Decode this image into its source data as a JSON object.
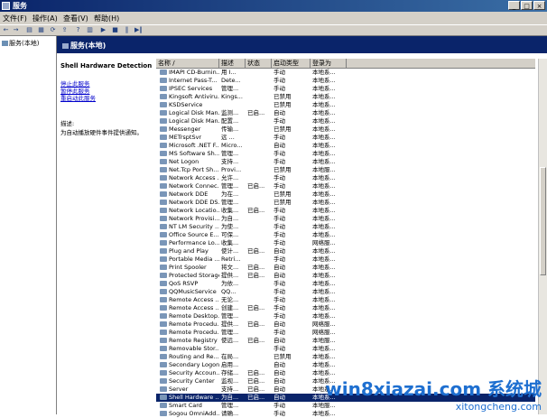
{
  "window": {
    "title": "服务"
  },
  "menu": [
    "文件(F)",
    "操作(A)",
    "查看(V)",
    "帮助(H)"
  ],
  "tree": {
    "root": "服务(本地)"
  },
  "header": {
    "title": "服务(本地)"
  },
  "desc": {
    "service_name": "Shell Hardware Detection",
    "link_stop": "停止此服务",
    "link_pause": "暂停此服务",
    "link_restart": "重启动此服务",
    "desc_label": "描述:",
    "desc_text": "为自动播放硬件事件提供通知。"
  },
  "columns": [
    "名称 /",
    "描述",
    "状态",
    "启动类型",
    "登录为"
  ],
  "services": [
    {
      "name": "IMAPI CD-Burnin...",
      "desc": "用 I...",
      "status": "",
      "startup": "手动",
      "logon": "本地系..."
    },
    {
      "name": "Internet Pass-T...",
      "desc": "Dete...",
      "status": "",
      "startup": "手动",
      "logon": "本地系..."
    },
    {
      "name": "IPSEC Services",
      "desc": "管理...",
      "status": "",
      "startup": "手动",
      "logon": "本地系..."
    },
    {
      "name": "Kingsoft Antiviru...",
      "desc": "Kings...",
      "status": "",
      "startup": "已禁用",
      "logon": "本地系..."
    },
    {
      "name": "KSDService",
      "desc": "",
      "status": "",
      "startup": "已禁用",
      "logon": "本地系..."
    },
    {
      "name": "Logical Disk Man...",
      "desc": "监测...",
      "status": "已启...",
      "startup": "自动",
      "logon": "本地系..."
    },
    {
      "name": "Logical Disk Man...",
      "desc": "配置...",
      "status": "",
      "startup": "手动",
      "logon": "本地系..."
    },
    {
      "name": "Messenger",
      "desc": "传输...",
      "status": "",
      "startup": "已禁用",
      "logon": "本地系..."
    },
    {
      "name": "METrsptSvr",
      "desc": "远 ...",
      "status": "",
      "startup": "手动",
      "logon": "本地系..."
    },
    {
      "name": "Microsoft .NET F...",
      "desc": "Micro...",
      "status": "",
      "startup": "自动",
      "logon": "本地系..."
    },
    {
      "name": "MS Software Sh...",
      "desc": "管理...",
      "status": "",
      "startup": "手动",
      "logon": "本地系..."
    },
    {
      "name": "Net Logon",
      "desc": "支持...",
      "status": "",
      "startup": "手动",
      "logon": "本地系..."
    },
    {
      "name": "Net.Tcp Port Sh...",
      "desc": "Provi...",
      "status": "",
      "startup": "已禁用",
      "logon": "本地服..."
    },
    {
      "name": "Network Access ...",
      "desc": "允许...",
      "status": "",
      "startup": "手动",
      "logon": "本地系..."
    },
    {
      "name": "Network Connec...",
      "desc": "管理...",
      "status": "已启...",
      "startup": "手动",
      "logon": "本地系..."
    },
    {
      "name": "Network DDE",
      "desc": "为在...",
      "status": "",
      "startup": "已禁用",
      "logon": "本地系..."
    },
    {
      "name": "Network DDE DS...",
      "desc": "管理...",
      "status": "",
      "startup": "已禁用",
      "logon": "本地系..."
    },
    {
      "name": "Network Locatio...",
      "desc": "收集...",
      "status": "已启...",
      "startup": "手动",
      "logon": "本地系..."
    },
    {
      "name": "Network Provisi...",
      "desc": "为自...",
      "status": "",
      "startup": "手动",
      "logon": "本地系..."
    },
    {
      "name": "NT LM Security ...",
      "desc": "为使...",
      "status": "",
      "startup": "手动",
      "logon": "本地系..."
    },
    {
      "name": "Office Source E...",
      "desc": "可保...",
      "status": "",
      "startup": "手动",
      "logon": "本地系..."
    },
    {
      "name": "Performance Lo...",
      "desc": "收集...",
      "status": "",
      "startup": "手动",
      "logon": "网络服..."
    },
    {
      "name": "Plug and Play",
      "desc": "使计...",
      "status": "已启...",
      "startup": "自动",
      "logon": "本地系..."
    },
    {
      "name": "Portable Media ...",
      "desc": "Retri...",
      "status": "",
      "startup": "手动",
      "logon": "本地系..."
    },
    {
      "name": "Print Spooler",
      "desc": "将文...",
      "status": "已启...",
      "startup": "自动",
      "logon": "本地系..."
    },
    {
      "name": "Protected Storage",
      "desc": "提供...",
      "status": "已启...",
      "startup": "自动",
      "logon": "本地系..."
    },
    {
      "name": "QoS RSVP",
      "desc": "为依...",
      "status": "",
      "startup": "手动",
      "logon": "本地系..."
    },
    {
      "name": "QQMusicService",
      "desc": "QQ...",
      "status": "",
      "startup": "手动",
      "logon": "本地系..."
    },
    {
      "name": "Remote Access ...",
      "desc": "无论...",
      "status": "",
      "startup": "手动",
      "logon": "本地系..."
    },
    {
      "name": "Remote Access ...",
      "desc": "创建...",
      "status": "已启...",
      "startup": "手动",
      "logon": "本地系..."
    },
    {
      "name": "Remote Desktop...",
      "desc": "管理...",
      "status": "",
      "startup": "手动",
      "logon": "本地系..."
    },
    {
      "name": "Remote Procedu...",
      "desc": "提供...",
      "status": "已启...",
      "startup": "自动",
      "logon": "网络服..."
    },
    {
      "name": "Remote Procedu...",
      "desc": "管理...",
      "status": "",
      "startup": "手动",
      "logon": "网络服..."
    },
    {
      "name": "Remote Registry",
      "desc": "使远...",
      "status": "已启...",
      "startup": "自动",
      "logon": "本地服..."
    },
    {
      "name": "Removable Stor...",
      "desc": "",
      "status": "",
      "startup": "手动",
      "logon": "本地系..."
    },
    {
      "name": "Routing and Re...",
      "desc": "在局...",
      "status": "",
      "startup": "已禁用",
      "logon": "本地系..."
    },
    {
      "name": "Secondary Logon",
      "desc": "启用...",
      "status": "",
      "startup": "自动",
      "logon": "本地系..."
    },
    {
      "name": "Security Accoun...",
      "desc": "存储...",
      "status": "已启...",
      "startup": "自动",
      "logon": "本地系..."
    },
    {
      "name": "Security Center",
      "desc": "监视...",
      "status": "已启...",
      "startup": "自动",
      "logon": "本地系..."
    },
    {
      "name": "Server",
      "desc": "支持...",
      "status": "已启...",
      "startup": "自动",
      "logon": "本地系..."
    },
    {
      "name": "Shell Hardware ...",
      "desc": "为自...",
      "status": "已启...",
      "startup": "自动",
      "logon": "本地系...",
      "selected": true
    },
    {
      "name": "Smart Card",
      "desc": "管理...",
      "status": "",
      "startup": "手动",
      "logon": "本地服..."
    },
    {
      "name": "Sogou OmniAdd...",
      "desc": "请确...",
      "status": "",
      "startup": "手动",
      "logon": "本地系..."
    }
  ],
  "watermark": {
    "line1": "win8xiazai.com 系统城",
    "line2": "xitongcheng.com"
  }
}
